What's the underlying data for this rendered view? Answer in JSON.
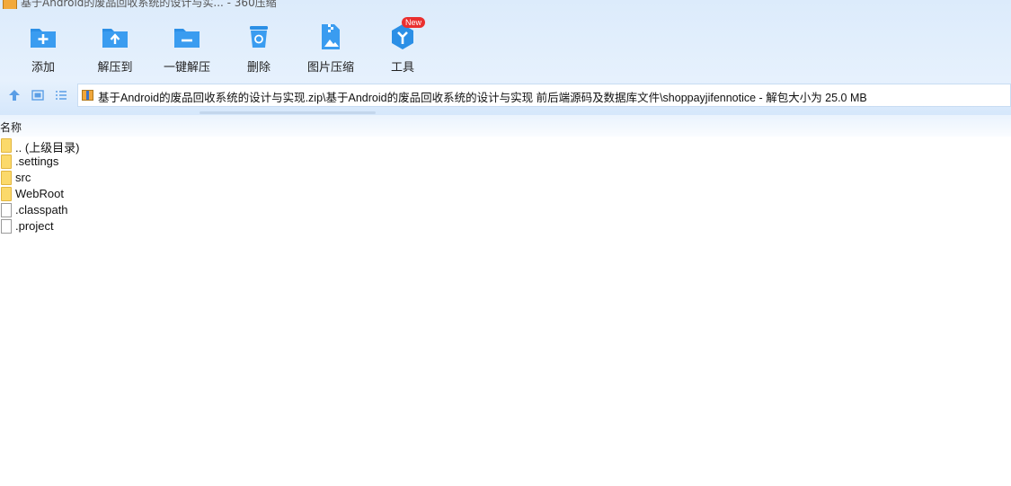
{
  "window": {
    "title": "基于Android的废品回收系统的设计与实... - 360压缩"
  },
  "toolbar": {
    "items": [
      {
        "label": "添加",
        "icon": "add-folder-icon"
      },
      {
        "label": "解压到",
        "icon": "extract-to-icon"
      },
      {
        "label": "一键解压",
        "icon": "one-click-extract-icon"
      },
      {
        "label": "删除",
        "icon": "delete-icon"
      },
      {
        "label": "图片压缩",
        "icon": "image-compress-icon"
      },
      {
        "label": "工具",
        "icon": "tools-icon",
        "badge": "New"
      }
    ]
  },
  "navigation": {
    "path": "基于Android的废品回收系统的设计与实现.zip\\基于Android的废品回收系统的设计与实现 前后端源码及数据库文件\\shoppayjifennotice - 解包大小为 25.0 MB"
  },
  "file_list": {
    "column_name": "名称",
    "items": [
      {
        "name": ".. (上级目录)",
        "type": "folder"
      },
      {
        "name": ".settings",
        "type": "folder"
      },
      {
        "name": "src",
        "type": "folder"
      },
      {
        "name": "WebRoot",
        "type": "folder"
      },
      {
        "name": ".classpath",
        "type": "file"
      },
      {
        "name": ".project",
        "type": "file"
      }
    ]
  },
  "colors": {
    "accent": "#2b8fe6",
    "header_bg": "#dcebfb",
    "folder": "#fbd96b",
    "badge": "#ea2f2f"
  }
}
